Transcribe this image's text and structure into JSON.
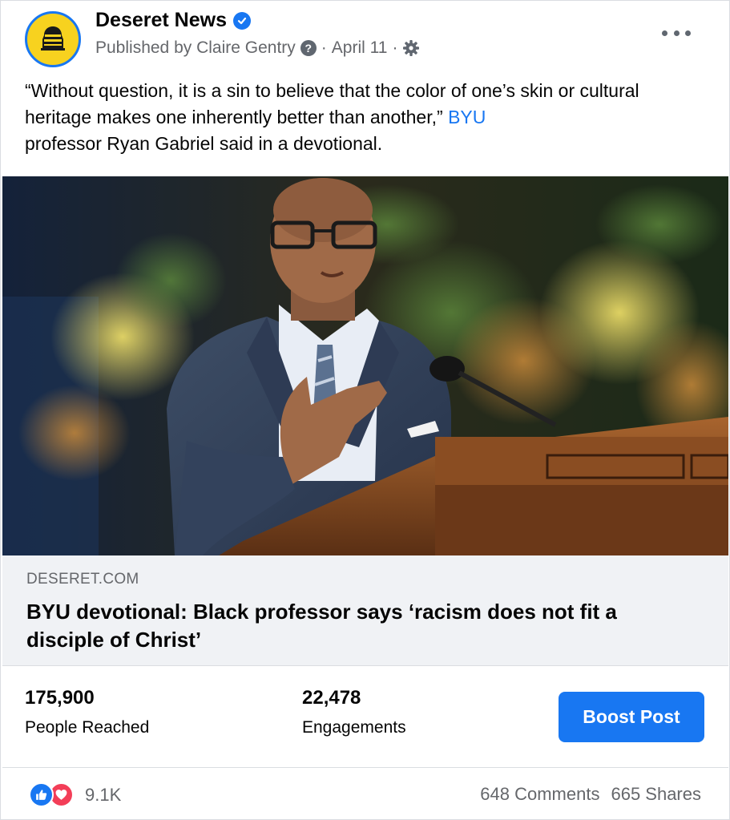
{
  "post": {
    "page_name": "Deseret News",
    "published_by": "Published by Claire Gentry",
    "separator": "·",
    "date": "April 11",
    "caption_text": "“Without question, it is a sin to believe that the color of one’s skin or cultural heritage makes one inherently better than another,”",
    "caption_link": "BYU",
    "caption_end": "professor Ryan Gabriel said in a devotional."
  },
  "link_preview": {
    "domain": "DESERET.COM",
    "headline": "BYU devotional: Black professor says ‘racism does not fit a disciple of Christ’"
  },
  "stats": {
    "reached_value": "175,900",
    "reached_label": "People Reached",
    "engagements_value": "22,478",
    "engagements_label": "Engagements",
    "boost_label": "Boost Post"
  },
  "footer": {
    "reaction_count": "9.1K",
    "comments": "648 Comments",
    "shares": "665 Shares"
  },
  "icons": [
    "beehive-logo-icon",
    "verified-icon",
    "help-icon",
    "gear-icon",
    "more-icon",
    "like-icon",
    "love-icon"
  ],
  "colors": {
    "accent": "#1877f2",
    "love": "#f33e58",
    "logo": "#f7d21f",
    "muted": "#65676b"
  }
}
